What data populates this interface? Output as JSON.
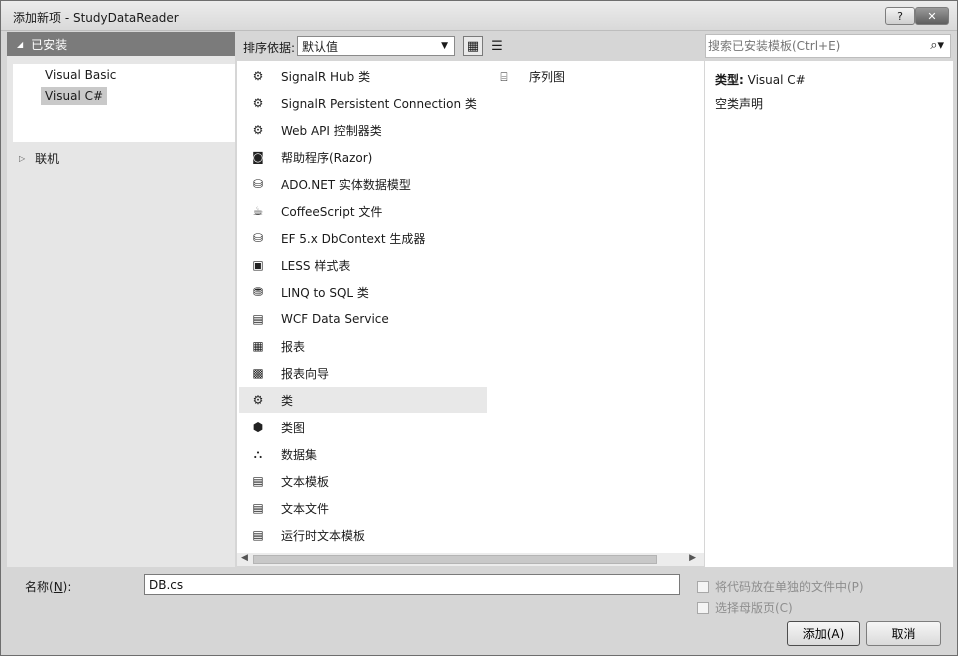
{
  "window": {
    "title": "添加新项 - StudyDataReader",
    "help_label": "?",
    "close_label": "✕"
  },
  "left": {
    "installed_label": "已安装",
    "languages": [
      "Visual Basic",
      "Visual C#"
    ],
    "selected_language": "Visual C#",
    "online_label": "联机"
  },
  "toolbar": {
    "sort_label": "排序依据:",
    "sort_value": "默认值"
  },
  "templates": [
    {
      "label": "SignalR Hub 类",
      "icon": "class-icon"
    },
    {
      "label": "SignalR Persistent Connection 类",
      "icon": "class-icon"
    },
    {
      "label": "Web API 控制器类",
      "icon": "class-icon"
    },
    {
      "label": "帮助程序(Razor)",
      "icon": "razor-helper-icon"
    },
    {
      "label": "ADO.NET 实体数据模型",
      "icon": "entity-model-icon"
    },
    {
      "label": "CoffeeScript 文件",
      "icon": "coffee-icon"
    },
    {
      "label": "EF 5.x DbContext 生成器",
      "icon": "entity-model-icon"
    },
    {
      "label": "LESS 样式表",
      "icon": "stylesheet-icon"
    },
    {
      "label": "LINQ to SQL 类",
      "icon": "linq-icon"
    },
    {
      "label": "WCF Data Service",
      "icon": "wcf-service-icon"
    },
    {
      "label": "报表",
      "icon": "report-icon"
    },
    {
      "label": "报表向导",
      "icon": "report-wizard-icon"
    },
    {
      "label": "类",
      "icon": "class-icon"
    },
    {
      "label": "类图",
      "icon": "class-diagram-icon"
    },
    {
      "label": "数据集",
      "icon": "dataset-icon"
    },
    {
      "label": "文本模板",
      "icon": "text-template-icon"
    },
    {
      "label": "文本文件",
      "icon": "text-file-icon"
    },
    {
      "label": "运行时文本模板",
      "icon": "text-template-icon"
    }
  ],
  "selected_template": "类",
  "templates_col2": [
    {
      "label": "序列图",
      "icon": "sequence-diagram-icon"
    }
  ],
  "search": {
    "placeholder": "搜索已安装模板(Ctrl+E)"
  },
  "details": {
    "type_label": "类型:",
    "type_value": "Visual C#",
    "description": "空类声明"
  },
  "bottom": {
    "name_label_prefix": "名称(",
    "name_label_key": "N",
    "name_label_suffix": "):",
    "name_value": "DB.cs",
    "separate_file_label": "将代码放在单独的文件中(P)",
    "master_page_label": "选择母版页(C)",
    "add_label": "添加(A)",
    "cancel_label": "取消"
  }
}
